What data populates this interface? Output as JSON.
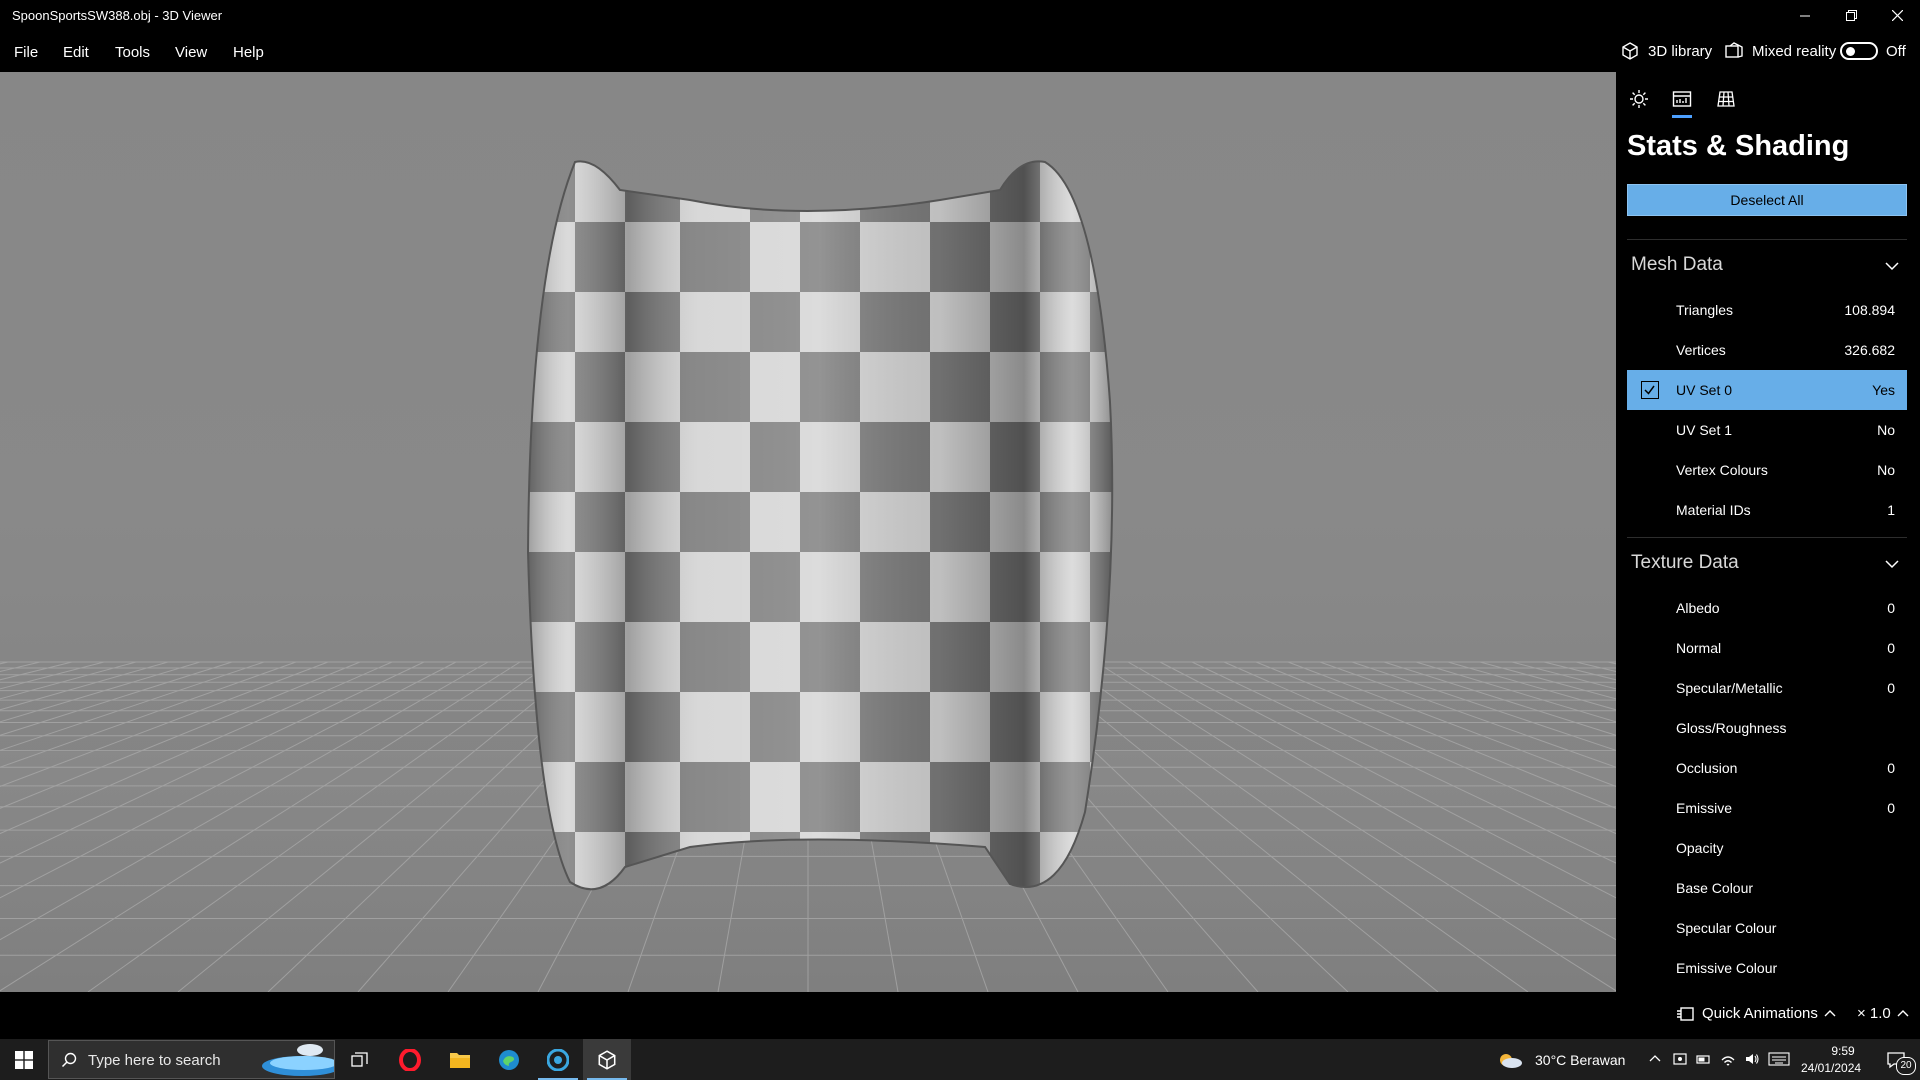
{
  "window": {
    "title": "SpoonSportsSW388.obj - 3D Viewer"
  },
  "menu": {
    "items": [
      "File",
      "Edit",
      "Tools",
      "View",
      "Help"
    ]
  },
  "header_right": {
    "library_label": "3D library",
    "mixed_reality_label": "Mixed reality",
    "mixed_reality_state": "Off"
  },
  "panel": {
    "tabs": [
      "lighting-icon",
      "stats-icon",
      "grid-icon"
    ],
    "title": "Stats & Shading",
    "deselect_label": "Deselect All",
    "mesh_section": {
      "title": "Mesh Data",
      "rows": [
        {
          "label": "Triangles",
          "value": "108.894"
        },
        {
          "label": "Vertices",
          "value": "326.682"
        },
        {
          "label": "UV Set 0",
          "value": "Yes"
        },
        {
          "label": "UV Set 1",
          "value": "No"
        },
        {
          "label": "Vertex Colours",
          "value": "No"
        },
        {
          "label": "Material IDs",
          "value": "1"
        }
      ]
    },
    "texture_section": {
      "title": "Texture Data",
      "rows": [
        {
          "label": "Albedo",
          "value": "0"
        },
        {
          "label": "Normal",
          "value": "0"
        },
        {
          "label": "Specular/Metallic",
          "value": "0"
        },
        {
          "label": "Gloss/Roughness",
          "value": ""
        },
        {
          "label": "Occlusion",
          "value": "0"
        },
        {
          "label": "Emissive",
          "value": "0"
        },
        {
          "label": "Opacity",
          "value": ""
        },
        {
          "label": "Base Colour",
          "value": ""
        },
        {
          "label": "Specular Colour",
          "value": ""
        },
        {
          "label": "Emissive Colour",
          "value": ""
        }
      ]
    }
  },
  "statusbar": {
    "quick_animations_label": "Quick Animations",
    "speed_label": "× 1.0"
  },
  "taskbar": {
    "search_placeholder": "Type here to search",
    "weather": "30°C  Berawan",
    "time": "9:59",
    "date": "24/01/2024",
    "notification_count": "20"
  },
  "colors": {
    "accent": "#67aee8",
    "tab_indicator": "#4da0ff",
    "viewport_bg": "#888888"
  }
}
